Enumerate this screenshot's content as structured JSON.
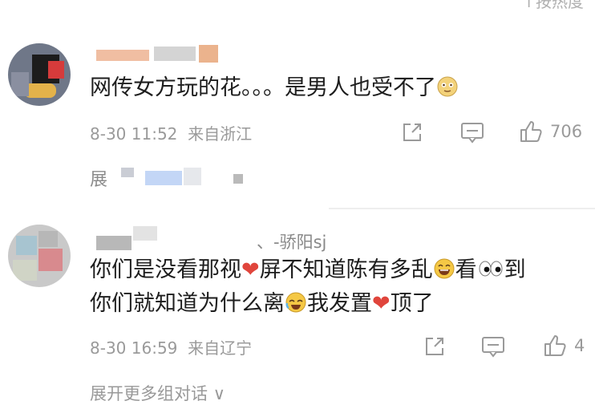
{
  "header": {
    "sort_label": "↑按热度"
  },
  "comments": [
    {
      "text": "网传女方玩的花。。。是男人也受不了",
      "date": "8-30",
      "time": "11:52",
      "location": "来自浙江",
      "likes": "706",
      "expand_label": "展"
    },
    {
      "username_visible": "、-骄阳sj",
      "text_line1_a": "你们是没看那视",
      "text_line1_b": "屏不知道陈有多乱",
      "text_line1_c": "看",
      "text_line1_d": "到",
      "text_line2_a": "你们就知道为什么离",
      "text_line2_b": "我发置",
      "text_line2_c": "顶了",
      "date": "8-30",
      "time": "16:59",
      "location": "来自辽宁",
      "likes": "4",
      "more_label": "展开更多组对话 ∨"
    }
  ]
}
